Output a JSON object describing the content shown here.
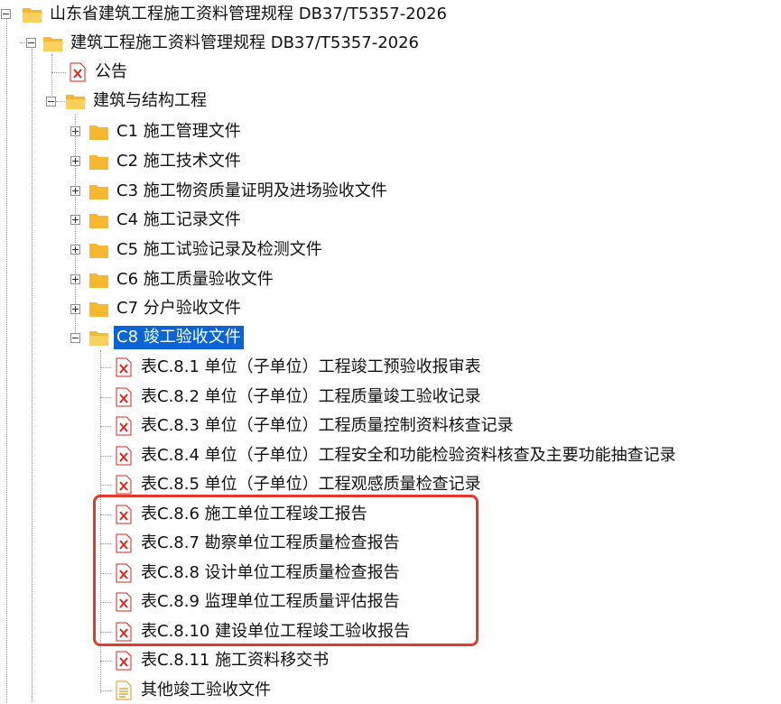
{
  "tree": {
    "root": {
      "label": "山东省建筑工程施工资料管理规程 DB37/T5357-2026",
      "expanded": true
    },
    "standard": {
      "label": "建筑工程施工资料管理规程 DB37/T5357-2026",
      "expanded": true
    },
    "notice": {
      "label": "公告",
      "icon": "pdf-file-icon"
    },
    "category": {
      "label": "建筑与结构工程",
      "expanded": true
    },
    "folders": [
      {
        "label": "C1 施工管理文件",
        "expanded": false
      },
      {
        "label": "C2 施工技术文件",
        "expanded": false
      },
      {
        "label": "C3 施工物资质量证明及进场验收文件",
        "expanded": false
      },
      {
        "label": "C4 施工记录文件",
        "expanded": false
      },
      {
        "label": "C5 施工试验记录及检测文件",
        "expanded": false
      },
      {
        "label": "C6 施工质量验收文件",
        "expanded": false
      },
      {
        "label": "C7 分户验收文件",
        "expanded": false
      },
      {
        "label": "C8 竣工验收文件",
        "expanded": true,
        "selected": true
      }
    ],
    "c8_items": [
      {
        "label": "表C.8.1 单位（子单位）工程竣工预验收报审表",
        "icon": "pdf-file-icon"
      },
      {
        "label": "表C.8.2 单位（子单位）工程质量竣工验收记录",
        "icon": "pdf-file-icon"
      },
      {
        "label": "表C.8.3 单位（子单位）工程质量控制资料核查记录",
        "icon": "pdf-file-icon"
      },
      {
        "label": "表C.8.4 单位（子单位）工程安全和功能检验资料核查及主要功能抽查记录",
        "icon": "pdf-file-icon"
      },
      {
        "label": "表C.8.5 单位（子单位）工程观感质量检查记录",
        "icon": "pdf-file-icon"
      },
      {
        "label": "表C.8.6 施工单位工程竣工报告",
        "icon": "pdf-file-icon"
      },
      {
        "label": "表C.8.7 勘察单位工程质量检查报告",
        "icon": "pdf-file-icon"
      },
      {
        "label": "表C.8.8 设计单位工程质量检查报告",
        "icon": "pdf-file-icon"
      },
      {
        "label": "表C.8.9 监理单位工程质量评估报告",
        "icon": "pdf-file-icon"
      },
      {
        "label": "表C.8.10 建设单位工程竣工验收报告",
        "icon": "pdf-file-icon"
      },
      {
        "label": "表C.8.11 施工资料移交书",
        "icon": "pdf-file-icon"
      },
      {
        "label": "其他竣工验收文件",
        "icon": "text-file-icon"
      }
    ]
  },
  "colors": {
    "selection": "#0a64d8",
    "highlight_box": "#e03a2a",
    "folder": "#f5b82e",
    "pdf_icon": "#d9261c"
  }
}
